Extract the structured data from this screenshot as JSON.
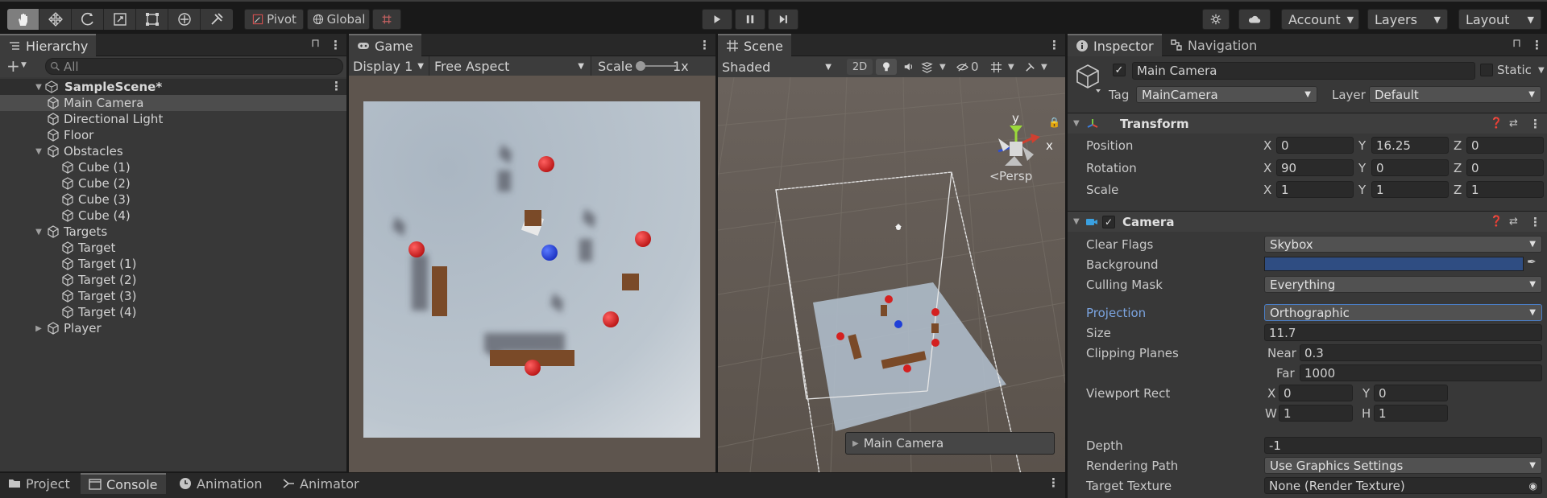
{
  "toolbar": {
    "tools": [
      "hand-tool",
      "move-tool",
      "rotate-tool",
      "scale-tool",
      "rect-tool",
      "transform-tool",
      "custom-tool"
    ],
    "pivot_label": "Pivot",
    "global_label": "Global",
    "account_label": "Account",
    "layers_label": "Layers",
    "layout_label": "Layout"
  },
  "hierarchy": {
    "tab_label": "Hierarchy",
    "search_placeholder": "All",
    "scene_name": "SampleScene*",
    "items": [
      {
        "label": "Main Camera",
        "indent": 1,
        "selected": true
      },
      {
        "label": "Directional Light",
        "indent": 1
      },
      {
        "label": "Floor",
        "indent": 1
      },
      {
        "label": "Obstacles",
        "indent": 1,
        "expanded": true
      },
      {
        "label": "Cube (1)",
        "indent": 2
      },
      {
        "label": "Cube (2)",
        "indent": 2
      },
      {
        "label": "Cube (3)",
        "indent": 2
      },
      {
        "label": "Cube (4)",
        "indent": 2
      },
      {
        "label": "Targets",
        "indent": 1,
        "expanded": true
      },
      {
        "label": "Target",
        "indent": 2
      },
      {
        "label": "Target (1)",
        "indent": 2
      },
      {
        "label": "Target (2)",
        "indent": 2
      },
      {
        "label": "Target (3)",
        "indent": 2
      },
      {
        "label": "Target (4)",
        "indent": 2
      },
      {
        "label": "Player",
        "indent": 1,
        "collapsed": true
      }
    ]
  },
  "game": {
    "tab_label": "Game",
    "display": "Display 1",
    "aspect": "Free Aspect",
    "scale_label": "Scale",
    "scale_value": "1x"
  },
  "scene": {
    "tab_label": "Scene",
    "shading": "Shaded",
    "mode_2d": "2D",
    "hidden_count": "0",
    "persp_label": "Persp",
    "gizmo_y": "y",
    "gizmo_x": "x",
    "camera_preview_label": "Main Camera"
  },
  "inspector": {
    "tab_label": "Inspector",
    "nav_tab_label": "Navigation",
    "object_name": "Main Camera",
    "static_label": "Static",
    "tag_label": "Tag",
    "tag_value": "MainCamera",
    "layer_label": "Layer",
    "layer_value": "Default",
    "transform": {
      "title": "Transform",
      "position_label": "Position",
      "rotation_label": "Rotation",
      "scale_label": "Scale",
      "position": {
        "x": "0",
        "y": "16.25",
        "z": "0"
      },
      "rotation": {
        "x": "90",
        "y": "0",
        "z": "0"
      },
      "scale": {
        "x": "1",
        "y": "1",
        "z": "1"
      }
    },
    "camera": {
      "title": "Camera",
      "clear_flags_label": "Clear Flags",
      "clear_flags": "Skybox",
      "background_label": "Background",
      "background_color": "#2f4d82",
      "culling_mask_label": "Culling Mask",
      "culling_mask": "Everything",
      "projection_label": "Projection",
      "projection": "Orthographic",
      "size_label": "Size",
      "size": "11.7",
      "clipping_label": "Clipping Planes",
      "near_label": "Near",
      "near": "0.3",
      "far_label": "Far",
      "far": "1000",
      "viewport_label": "Viewport Rect",
      "viewport": {
        "x": "0",
        "y": "0",
        "w": "1",
        "h": "1"
      },
      "depth_label": "Depth",
      "depth": "-1",
      "rendering_path_label": "Rendering Path",
      "rendering_path": "Use Graphics Settings",
      "target_texture_label": "Target Texture",
      "target_texture": "None (Render Texture)"
    }
  },
  "bottom_tabs": {
    "project": "Project",
    "console": "Console",
    "animation": "Animation",
    "animator": "Animator"
  },
  "colors": {
    "selection_blue": "#46607c",
    "projection_highlight": "#7ba4e0",
    "target_red": "#d42020",
    "player_blue": "#1f3fd8",
    "obstacle_brown": "#7a4a28"
  }
}
